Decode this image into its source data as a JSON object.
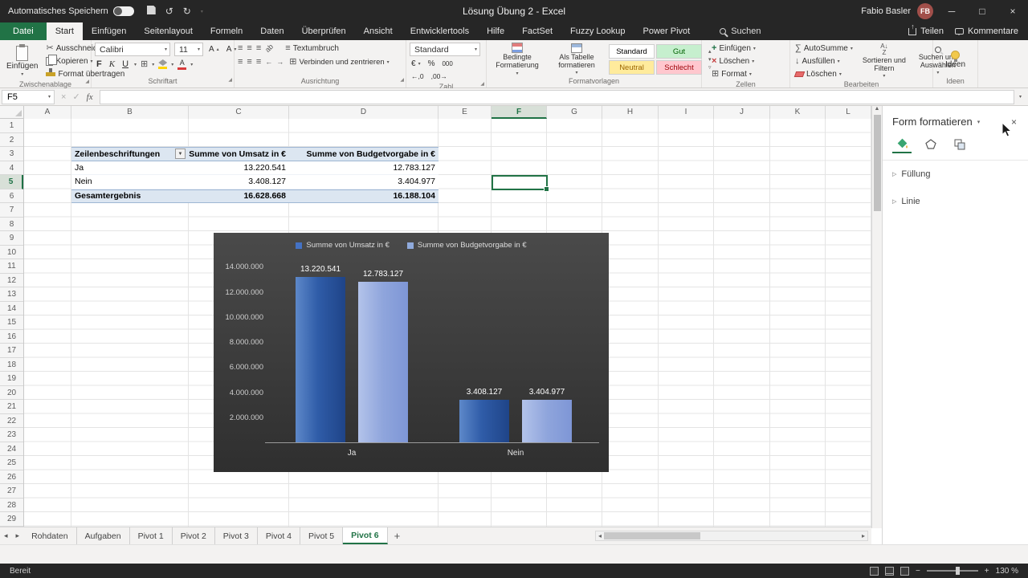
{
  "title_bar": {
    "autosave_label": "Automatisches Speichern",
    "title": "Lösung Übung 2 - Excel",
    "user_name": "Fabio Basler",
    "user_initials": "FB"
  },
  "ribbon_tabs": {
    "file": "Datei",
    "tabs": [
      "Start",
      "Einfügen",
      "Seitenlayout",
      "Formeln",
      "Daten",
      "Überprüfen",
      "Ansicht",
      "Entwicklertools",
      "Hilfe",
      "FactSet",
      "Fuzzy Lookup",
      "Power Pivot"
    ],
    "active": "Start",
    "search": "Suchen",
    "share": "Teilen",
    "comments": "Kommentare"
  },
  "ribbon": {
    "clipboard": {
      "paste": "Einfügen",
      "cut": "Ausschneiden",
      "copy": "Kopieren",
      "painter": "Format übertragen",
      "label": "Zwischenablage"
    },
    "font": {
      "name": "Calibri",
      "size": "11",
      "bold": "F",
      "italic": "K",
      "underline": "U",
      "label": "Schriftart"
    },
    "alignment": {
      "wrap": "Textumbruch",
      "merge": "Verbinden und zentrieren",
      "label": "Ausrichtung"
    },
    "number": {
      "format": "Standard",
      "label": "Zahl"
    },
    "styles": {
      "conditional": "Bedingte Formatierung",
      "as_table": "Als Tabelle formatieren",
      "items": [
        {
          "label": "Standard",
          "bg": "#ffffff",
          "color": "#000000"
        },
        {
          "label": "Gut",
          "bg": "#c6efce",
          "color": "#006100"
        },
        {
          "label": "Neutral",
          "bg": "#ffeb9c",
          "color": "#9c6500"
        },
        {
          "label": "Schlecht",
          "bg": "#ffc7ce",
          "color": "#9c0006"
        }
      ],
      "label": "Formatvorlagen"
    },
    "cells": {
      "insert": "Einfügen",
      "delete": "Löschen",
      "format": "Format",
      "label": "Zellen"
    },
    "editing": {
      "autosum": "AutoSumme",
      "fill": "Ausfüllen",
      "clear": "Löschen",
      "sort_1": "Sortieren und",
      "sort_2": "Filtern",
      "find_1": "Suchen und",
      "find_2": "Auswählen",
      "label": "Bearbeiten"
    },
    "ideas": {
      "button": "Ideen",
      "label": "Ideen"
    }
  },
  "formula_bar": {
    "name_box": "F5",
    "fx": "fx"
  },
  "grid": {
    "columns": [
      {
        "label": "A",
        "width": 59
      },
      {
        "label": "B",
        "width": 146
      },
      {
        "label": "C",
        "width": 125
      },
      {
        "label": "D",
        "width": 186
      },
      {
        "label": "E",
        "width": 66
      },
      {
        "label": "F",
        "width": 69
      },
      {
        "label": "G",
        "width": 69
      },
      {
        "label": "H",
        "width": 70
      },
      {
        "label": "I",
        "width": 69
      },
      {
        "label": "J",
        "width": 70
      },
      {
        "label": "K",
        "width": 69
      },
      {
        "label": "L",
        "width": 57
      }
    ],
    "row_count": 29,
    "selected_cell": "F5",
    "selected_column": "F",
    "selected_row": 5
  },
  "pivot_table": {
    "headers": [
      "Zeilenbeschriftungen",
      "Summe von Umsatz in €",
      "Summe von Budgetvorgabe in €"
    ],
    "rows": [
      [
        "Ja",
        "13.220.541",
        "12.783.127"
      ],
      [
        "Nein",
        "3.408.127",
        "3.404.977"
      ]
    ],
    "total": [
      "Gesamtergebnis",
      "16.628.668",
      "16.188.104"
    ]
  },
  "chart_data": {
    "type": "bar",
    "title": "",
    "categories": [
      "Ja",
      "Nein"
    ],
    "series": [
      {
        "name": "Summe von Umsatz in €",
        "color": "#4472c4",
        "values": [
          13220541,
          3408127
        ],
        "labels": [
          "13.220.541",
          "3.408.127"
        ]
      },
      {
        "name": "Summe von Budgetvorgabe in €",
        "color": "#8faadc",
        "values": [
          12783127,
          3404977
        ],
        "labels": [
          "12.783.127",
          "3.404.977"
        ]
      }
    ],
    "y_ticks": [
      {
        "v": 2000000,
        "label": "2.000.000"
      },
      {
        "v": 4000000,
        "label": "4.000.000"
      },
      {
        "v": 6000000,
        "label": "6.000.000"
      },
      {
        "v": 8000000,
        "label": "8.000.000"
      },
      {
        "v": 10000000,
        "label": "10.000.000"
      },
      {
        "v": 12000000,
        "label": "12.000.000"
      },
      {
        "v": 14000000,
        "label": "14.000.000"
      }
    ],
    "ylim": [
      0,
      14600000
    ],
    "legend_position": "top",
    "grid": false,
    "background": "#3d3d3d"
  },
  "format_pane": {
    "title": "Form formatieren",
    "sections": [
      "Füllung",
      "Linie"
    ]
  },
  "sheet_tabs": {
    "tabs": [
      "Rohdaten",
      "Aufgaben",
      "Pivot 1",
      "Pivot 2",
      "Pivot 3",
      "Pivot 4",
      "Pivot 5",
      "Pivot 6"
    ],
    "active": "Pivot 6"
  },
  "status_bar": {
    "ready": "Bereit",
    "zoom": "130 %"
  }
}
